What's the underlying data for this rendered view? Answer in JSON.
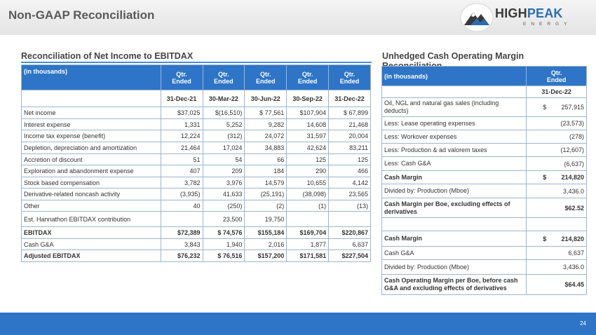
{
  "title": "Non-GAAP Reconciliation",
  "logo": {
    "text_a": "HIGH",
    "text_b": "PEAK",
    "sub": "ENERGY"
  },
  "page_number": "24",
  "left": {
    "heading": "Reconciliation of Net Income to EBITDAX",
    "label_header": "(in thousands)",
    "col_top": [
      "Qtr.",
      "Qtr.",
      "Qtr.",
      "Qtr.",
      "Qtr."
    ],
    "col_mid": [
      "Ended",
      "Ended",
      "Ended",
      "Ended",
      "Ended"
    ],
    "col_dates": [
      "31-Dec-21",
      "30-Mar-22",
      "30-Jun-22",
      "30-Sep-22",
      "31-Dec-22"
    ],
    "rows": [
      {
        "label": "Net income",
        "values": [
          "$37,025",
          "$(16,510)",
          "$ 77,561",
          "$107,904",
          "$ 67,899"
        ]
      },
      {
        "label": "Interest expense",
        "values": [
          "1,331",
          "5,252",
          "9,282",
          "14,608",
          "21,468"
        ]
      },
      {
        "label": "Income tax expense (benefit)",
        "values": [
          "12,224",
          "(312)",
          "24,072",
          "31,597",
          "20,004"
        ]
      },
      {
        "label": "Depletion, depreciation and amortization",
        "values": [
          "21,464",
          "17,024",
          "34,883",
          "42,624",
          "83,211"
        ]
      },
      {
        "label": "Accretion of discount",
        "values": [
          "51",
          "54",
          "66",
          "125",
          "125"
        ]
      },
      {
        "label": "Exploration and abandonment expense",
        "values": [
          "407",
          "209",
          "184",
          "290",
          "466"
        ]
      },
      {
        "label": "Stock based compensation",
        "values": [
          "3,782",
          "3,976",
          "14,579",
          "10,655",
          "4,142"
        ]
      },
      {
        "label": "Derivative-related noncash activity",
        "values": [
          "(3,935)",
          "41,633",
          "(25,191)",
          "(38,098)",
          "23,565"
        ]
      },
      {
        "label": "Other",
        "values": [
          "40",
          "(250)",
          "(2)",
          "(1)",
          "(13)"
        ]
      },
      {
        "label": "Est. Hannathon EBITDAX contribution",
        "values": [
          "",
          "23,500",
          "19,750",
          "",
          ""
        ]
      },
      {
        "label": "EBITDAX",
        "values": [
          "$72,389",
          "$ 74,576",
          "$155,184",
          "$169,704",
          "$220,867"
        ]
      },
      {
        "label": "Cash G&A",
        "values": [
          "3,843",
          "1,940",
          "2,016",
          "1,877",
          "6,637"
        ]
      },
      {
        "label": "Adjusted EBITDAX",
        "values": [
          "$76,232",
          "$ 76,516",
          "$157,200",
          "$171,581",
          "$227,504"
        ]
      }
    ]
  },
  "right": {
    "heading": "Unhedged Cash Operating Margin Reconciliation",
    "label_header": "(in thousands)",
    "col_top": "Qtr.",
    "col_mid": "Ended",
    "col_date": "31-Dec-22",
    "rows": [
      {
        "label": "Oil, NGL and natural gas sales (including deducts)",
        "currency": "$",
        "value": "257,915"
      },
      {
        "label": "Less: Lease operating expenses",
        "currency": "",
        "value": "(23,573)"
      },
      {
        "label": "Less: Workover expenses",
        "currency": "",
        "value": "(278)"
      },
      {
        "label": "Less: Production & ad valorem taxes",
        "currency": "",
        "value": "(12,607)"
      },
      {
        "label": "Less: Cash G&A",
        "currency": "",
        "value": "(6,637)"
      },
      {
        "label": "Cash Margin",
        "currency": "$",
        "value": "214,820"
      },
      {
        "label": "Divided by: Production (Mboe)",
        "currency": "",
        "value": "3,436.0"
      },
      {
        "label": "Cash Margin per Boe, excluding effects of derivatives",
        "currency": "",
        "value": "$62.52"
      },
      {
        "label": "",
        "currency": "",
        "value": ""
      },
      {
        "label": "Cash Margin",
        "currency": "$",
        "value": "214,820"
      },
      {
        "label": "Cash G&A",
        "currency": "",
        "value": "6,637"
      },
      {
        "label": "Divided by: Production (Mboe)",
        "currency": "",
        "value": "3,436.0"
      },
      {
        "label": "Cash Operating Margin per Boe, before cash G&A and excluding effects of derivatives",
        "currency": "",
        "value": "$64.45"
      }
    ]
  },
  "colors": {
    "accent": "#2e75c7",
    "rule": "#4a8fd1",
    "title": "#5a5a5a"
  }
}
